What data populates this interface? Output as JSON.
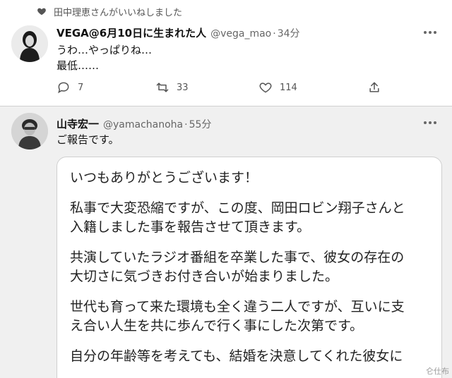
{
  "liked_banner": {
    "text": "田中理恵さんがいいねしました"
  },
  "tweet1": {
    "name": "VEGA@6月10日に生まれた人",
    "handle": "@vega_mao",
    "time": "34分",
    "lines": [
      "うわ…やっぱりね…",
      "最低……"
    ],
    "actions": {
      "replies": "7",
      "retweets": "33",
      "likes": "114"
    }
  },
  "tweet2": {
    "name": "山寺宏一",
    "handle": "@yamachanoha",
    "time": "55分",
    "text": "ご報告です。",
    "card": {
      "paragraphs": [
        [
          "いつもありがとうございます！"
        ],
        [
          "私事で大変恐縮ですが、この度、岡田ロビン翔子さんと",
          "入籍しました事を報告させて頂きます。"
        ],
        [
          "共演していたラジオ番組を卒業した事で、彼女の存在の",
          "大切さに気づきお付き合いが始まりました。"
        ],
        [
          "世代も育って来た環境も全く違う二人ですが、互いに支",
          "え合い人生を共に歩んで行く事にした次第です。"
        ],
        [
          "自分の年齢等を考えても、結婚を決意してくれた彼女に"
        ]
      ]
    }
  },
  "watermark": "仑仕布"
}
